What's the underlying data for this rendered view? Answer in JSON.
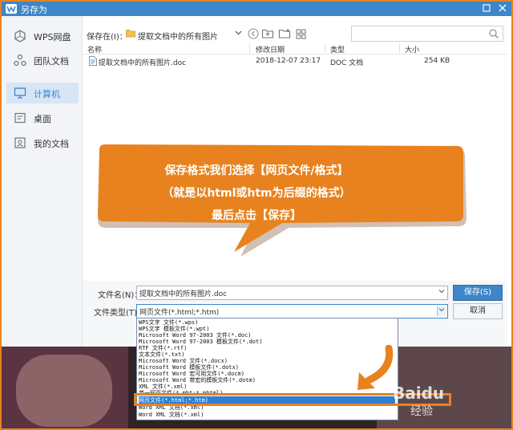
{
  "window": {
    "title": "另存为"
  },
  "sidebar": {
    "items": [
      {
        "label": "WPS网盘",
        "icon": "cloud-icon",
        "active": false
      },
      {
        "label": "团队文档",
        "icon": "team-icon",
        "active": false
      },
      {
        "label": "计算机",
        "icon": "computer-icon",
        "active": true
      },
      {
        "label": "桌面",
        "icon": "desktop-icon",
        "active": false
      },
      {
        "label": "我的文档",
        "icon": "documents-icon",
        "active": false
      }
    ]
  },
  "toolbar": {
    "save_in_label": "保存在(I)：",
    "save_in_value": "提取文档中的所有图片"
  },
  "file_list": {
    "headers": [
      "名称",
      "修改日期",
      "类型",
      "大小"
    ],
    "rows": [
      {
        "name": "提取文档中的所有图片.doc",
        "modified": "2018-12-07 23:17",
        "type": "DOC 文档",
        "size": "254 KB"
      }
    ]
  },
  "callout": {
    "lines": [
      "保存格式我们选择【网页文件/格式】",
      "（就是以html或htm为后缀的格式）",
      "最后点击【保存】"
    ],
    "color": "#e8821e"
  },
  "form": {
    "filename_label": "文件名(N)：",
    "filename_value": "提取文档中的所有图片.doc",
    "filetype_label": "文件类型(T)：",
    "filetype_value": "网页文件(*.html;*.htm)",
    "save_label": "保存(S)",
    "cancel_label": "取消"
  },
  "filetype_options": [
    "WPS文字 文件(*.wps)",
    "WPS文字 模板文件(*.wpt)",
    "Microsoft Word 97-2003 文件(*.doc)",
    "Microsoft Word 97-2003 模板文件(*.dot)",
    "RTF 文件(*.rtf)",
    "文本文件(*.txt)",
    "Microsoft Word 文件(*.docx)",
    "Microsoft Word 模板文件(*.dotx)",
    "Microsoft Word 宏可用文件(*.docm)",
    "Microsoft Word 带宏的模板文件(*.dotm)",
    "XML 文件(*.xml)",
    "单一网页文件(*.mht;*.mhtml)",
    "网页文件(*.html;*.htm)",
    "Word XML 文档(*.xml)",
    "Word XML 文档(*.xml)"
  ],
  "selected_option_index": 12,
  "colors": {
    "accent": "#3c86c9",
    "highlight": "#e8821e"
  },
  "watermark": {
    "text1": "Baidu",
    "text2": "经验"
  }
}
